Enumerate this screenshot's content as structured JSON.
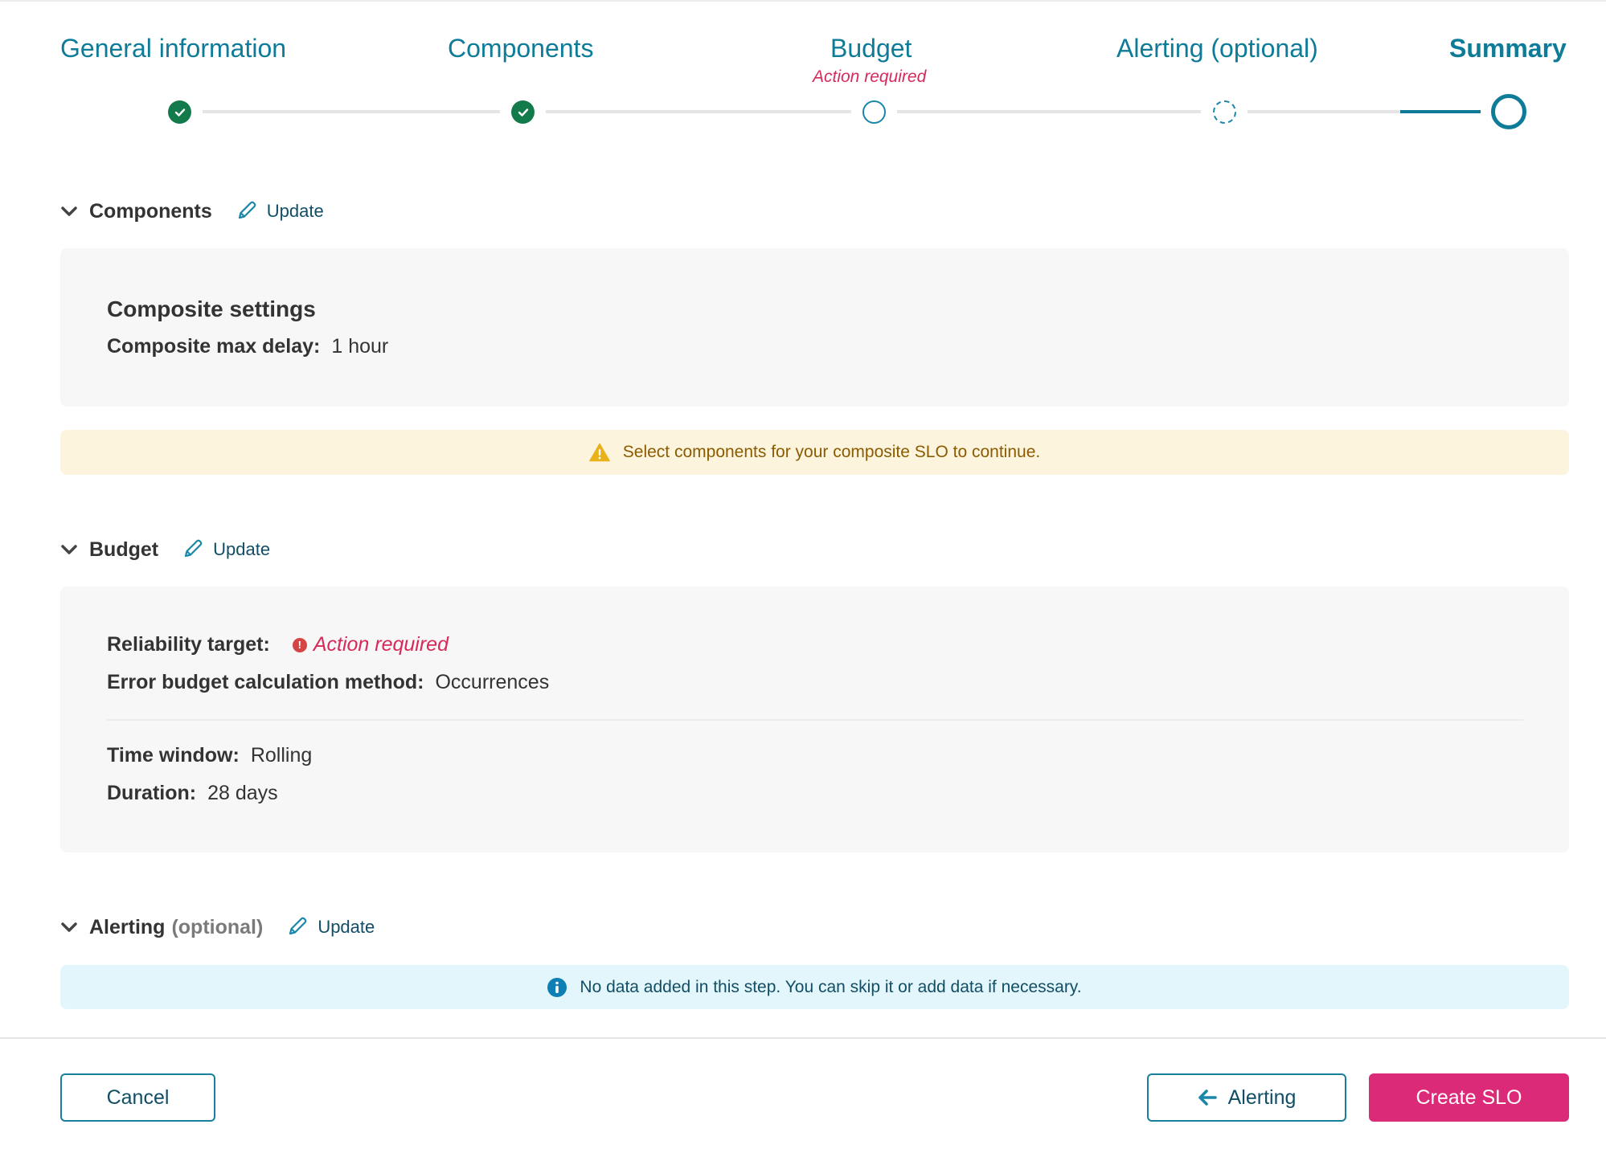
{
  "stepper": {
    "steps": [
      {
        "label": "General information",
        "status": "complete"
      },
      {
        "label": "Components",
        "status": "complete"
      },
      {
        "label": "Budget",
        "status": "incomplete",
        "note": "Action required"
      },
      {
        "label": "Alerting (optional)",
        "status": "optional"
      },
      {
        "label": "Summary",
        "status": "current"
      }
    ]
  },
  "sections": {
    "components": {
      "title": "Components",
      "update_label": "Update",
      "card_title": "Composite settings",
      "fields": [
        {
          "label": "Composite max delay:",
          "value": "1 hour"
        }
      ],
      "warning": "Select components for your composite SLO to continue."
    },
    "budget": {
      "title": "Budget",
      "update_label": "Update",
      "fields": [
        {
          "label": "Reliability target:",
          "value": "Action required",
          "state": "error"
        },
        {
          "label": "Error budget calculation method:",
          "value": "Occurrences"
        },
        {
          "label": "Time window:",
          "value": "Rolling"
        },
        {
          "label": "Duration:",
          "value": "28 days"
        }
      ]
    },
    "alerting": {
      "title": "Alerting",
      "optional_label": "(optional)",
      "update_label": "Update",
      "info": "No data added in this step. You can skip it or add data if necessary."
    }
  },
  "footer": {
    "cancel_label": "Cancel",
    "back_label": "Alerting",
    "create_label": "Create SLO"
  },
  "colors": {
    "accent": "#0e7c98",
    "success": "#137a4c",
    "error": "#d62a5a",
    "primary_button": "#db2a77",
    "warning_bg": "#fdf4dd",
    "info_bg": "#e3f6fb"
  }
}
